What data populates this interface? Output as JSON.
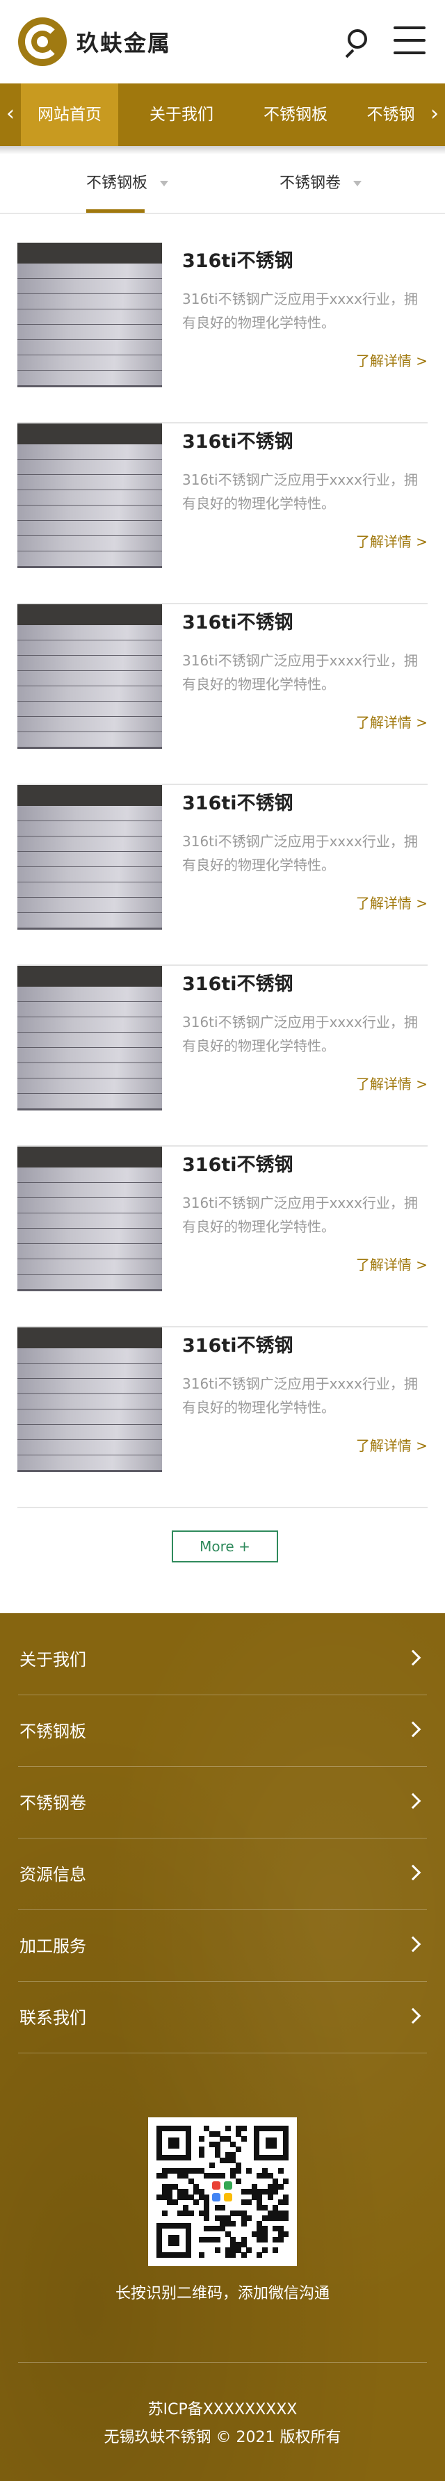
{
  "header": {
    "brand": "玖蚨金属",
    "brand_color": "#a0780d"
  },
  "nav": {
    "items": [
      {
        "label": "网站首页",
        "active": true
      },
      {
        "label": "关于我们"
      },
      {
        "label": "不锈钢板"
      },
      {
        "label": "不锈钢"
      }
    ],
    "prev_icon": "chevron-left-icon",
    "next_icon": "chevron-right-icon"
  },
  "tabs": [
    {
      "label": "不锈钢板",
      "active": true
    },
    {
      "label": "不锈钢卷"
    }
  ],
  "products": [
    {
      "title": "316ti不锈钢",
      "desc": "316ti不锈钢广泛应用于xxxx行业，拥有良好的物理化学特性。",
      "link": "了解详情 >"
    },
    {
      "title": "316ti不锈钢",
      "desc": "316ti不锈钢广泛应用于xxxx行业，拥有良好的物理化学特性。",
      "link": "了解详情 >"
    },
    {
      "title": "316ti不锈钢",
      "desc": "316ti不锈钢广泛应用于xxxx行业，拥有良好的物理化学特性。",
      "link": "了解详情 >"
    },
    {
      "title": "316ti不锈钢",
      "desc": "316ti不锈钢广泛应用于xxxx行业，拥有良好的物理化学特性。",
      "link": "了解详情 >"
    },
    {
      "title": "316ti不锈钢",
      "desc": "316ti不锈钢广泛应用于xxxx行业，拥有良好的物理化学特性。",
      "link": "了解详情 >"
    },
    {
      "title": "316ti不锈钢",
      "desc": "316ti不锈钢广泛应用于xxxx行业，拥有良好的物理化学特性。",
      "link": "了解详情 >"
    },
    {
      "title": "316ti不锈钢",
      "desc": "316ti不锈钢广泛应用于xxxx行业，拥有良好的物理化学特性。",
      "link": "了解详情 >"
    }
  ],
  "more_button": "More +",
  "footer": {
    "links": [
      "关于我们",
      "不锈钢板",
      "不锈钢卷",
      "资源信息",
      "加工服务",
      "联系我们"
    ],
    "qr_caption": "长按识别二维码，添加微信沟通",
    "icp": "苏ICP备XXXXXXXXX",
    "copyright": "无锡玖蚨不锈钢 © 2021 版权所有",
    "bg_color": "#866510"
  }
}
